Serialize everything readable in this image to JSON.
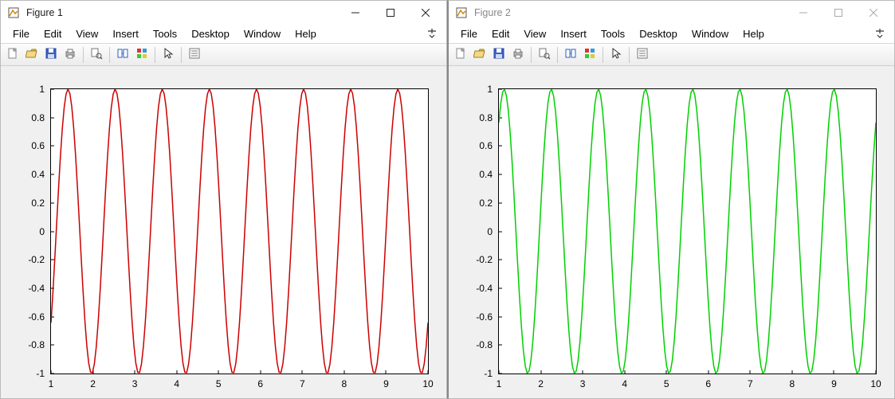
{
  "windows": [
    {
      "title": "Figure 1",
      "active": true,
      "menus": [
        "File",
        "Edit",
        "View",
        "Insert",
        "Tools",
        "Desktop",
        "Window",
        "Help"
      ],
      "toolbar": [
        "new",
        "open",
        "save",
        "print",
        "|",
        "print-preview",
        "|",
        "link-axes",
        "color-legend",
        "|",
        "cursor",
        "|",
        "properties"
      ],
      "chart": {
        "type": "line",
        "color": "#cc0000",
        "xlim": [
          1,
          10
        ],
        "ylim": [
          -1,
          1
        ],
        "xticks": [
          1,
          2,
          3,
          4,
          5,
          6,
          7,
          8,
          9,
          10
        ],
        "yticks": [
          -1,
          -0.8,
          -0.6,
          -0.4,
          -0.2,
          0,
          0.2,
          0.4,
          0.6,
          0.8,
          1
        ],
        "function": "sin",
        "angular_frequency_rad": 5.585,
        "phase_rad": 0,
        "samples": 200
      }
    },
    {
      "title": "Figure 2",
      "active": false,
      "menus": [
        "File",
        "Edit",
        "View",
        "Insert",
        "Tools",
        "Desktop",
        "Window",
        "Help"
      ],
      "toolbar": [
        "new",
        "open",
        "save",
        "print",
        "|",
        "print-preview",
        "|",
        "link-axes",
        "color-legend",
        "|",
        "cursor",
        "|",
        "properties"
      ],
      "chart": {
        "type": "line",
        "color": "#00d000",
        "xlim": [
          1,
          10
        ],
        "ylim": [
          -1,
          1
        ],
        "xticks": [
          1,
          2,
          3,
          4,
          5,
          6,
          7,
          8,
          9,
          10
        ],
        "yticks": [
          -1,
          -0.8,
          -0.6,
          -0.4,
          -0.2,
          0,
          0.2,
          0.4,
          0.6,
          0.8,
          1
        ],
        "function": "cos",
        "angular_frequency_rad": 5.585,
        "phase_rad": 0,
        "samples": 200
      }
    }
  ],
  "chart_data": [
    {
      "type": "line",
      "title": "",
      "xlabel": "",
      "ylabel": "",
      "xlim": [
        1,
        10
      ],
      "ylim": [
        -1,
        1
      ],
      "xticks": [
        1,
        2,
        3,
        4,
        5,
        6,
        7,
        8,
        9,
        10
      ],
      "yticks": [
        -1,
        -0.8,
        -0.6,
        -0.4,
        -0.2,
        0,
        0.2,
        0.4,
        0.6,
        0.8,
        1
      ],
      "series": [
        {
          "name": "sin(5.585·x)",
          "color": "#cc0000",
          "x_range": [
            1,
            10
          ],
          "y_formula": "sin(5.585*x)"
        }
      ]
    },
    {
      "type": "line",
      "title": "",
      "xlabel": "",
      "ylabel": "",
      "xlim": [
        1,
        10
      ],
      "ylim": [
        -1,
        1
      ],
      "xticks": [
        1,
        2,
        3,
        4,
        5,
        6,
        7,
        8,
        9,
        10
      ],
      "yticks": [
        -1,
        -0.8,
        -0.6,
        -0.4,
        -0.2,
        0,
        0.2,
        0.4,
        0.6,
        0.8,
        1
      ],
      "series": [
        {
          "name": "cos(5.585·x)",
          "color": "#00d000",
          "x_range": [
            1,
            10
          ],
          "y_formula": "cos(5.585*x)"
        }
      ]
    }
  ]
}
